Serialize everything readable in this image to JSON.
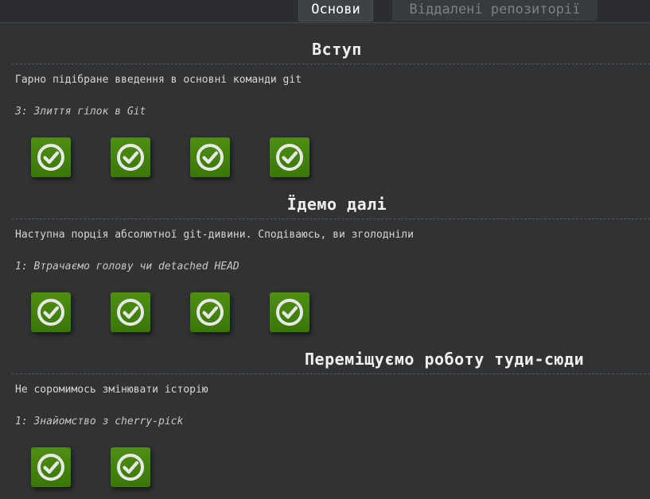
{
  "tabs": [
    {
      "label": "Основи",
      "active": true
    },
    {
      "label": "Віддалені репозиторії",
      "active": false
    }
  ],
  "sections": [
    {
      "title": "Вступ",
      "description": "Гарно підібране введення в основні команди git",
      "current_level": "3: Злиття гілок в Git",
      "levels": [
        {
          "status": "completed",
          "icon": "check-circle-icon"
        },
        {
          "status": "completed",
          "icon": "check-circle-icon"
        },
        {
          "status": "completed",
          "icon": "check-circle-icon"
        },
        {
          "status": "completed",
          "icon": "check-circle-icon"
        }
      ]
    },
    {
      "title": "Їдемо далі",
      "description": "Наступна порція абсолютної git-дивини. Сподіваюсь, ви зголодніли",
      "current_level": "1: Втрачаємо голову чи detached HEAD",
      "levels": [
        {
          "status": "completed",
          "icon": "check-circle-icon"
        },
        {
          "status": "completed",
          "icon": "check-circle-icon"
        },
        {
          "status": "completed",
          "icon": "check-circle-icon"
        },
        {
          "status": "completed",
          "icon": "check-circle-icon"
        }
      ]
    },
    {
      "title": "Переміщуємо роботу туди-сюди",
      "description": "Не соромимось змінювати історію",
      "current_level": "1: Знайомство з cherry-pick",
      "levels": [
        {
          "status": "completed",
          "icon": "check-circle-icon"
        },
        {
          "status": "completed",
          "icon": "check-circle-icon"
        }
      ]
    }
  ],
  "colors": {
    "background": "#303234",
    "completed_button": "#447f0c",
    "check": "#e8e8e8"
  }
}
